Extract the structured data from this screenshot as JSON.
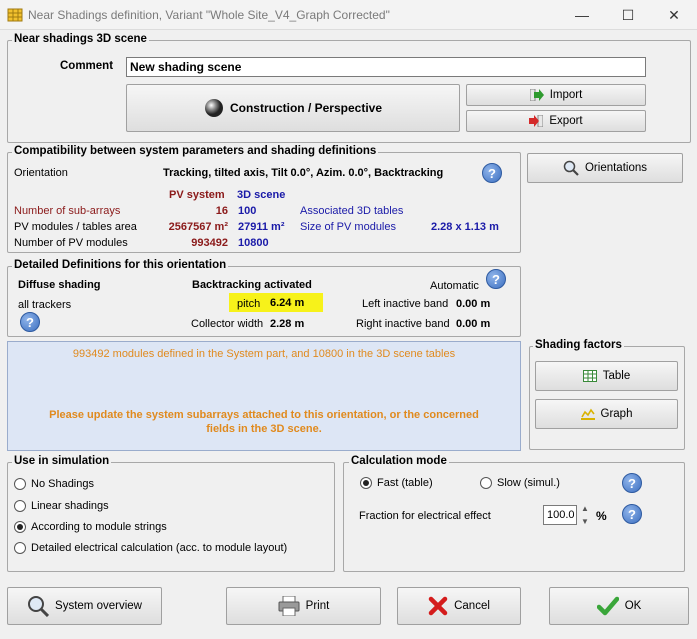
{
  "window": {
    "title": "Near Shadings definition, Variant \"Whole Site_V4_Graph Corrected\"",
    "minimize": "—",
    "maximize": "☐",
    "close": "✕"
  },
  "scene": {
    "group_label": "Near shadings 3D scene",
    "comment_label": "Comment",
    "comment_value": "New shading scene",
    "construction_label": "Construction / Perspective",
    "import_label": "Import",
    "export_label": "Export"
  },
  "compat": {
    "group_label": "Compatibility between system parameters and shading definitions",
    "orientation_label": "Orientation",
    "orientation_value": "Tracking, tilted axis, Tilt 0.0°, Azim. 0.0°, Backtracking",
    "pv_system_header": "PV system",
    "scene_header": "3D scene",
    "rows": [
      {
        "label": "Number of sub-arrays",
        "pv": "16",
        "scene": "100"
      },
      {
        "label": "PV modules / tables area",
        "pv": "2567567 m²",
        "scene": "27911 m²"
      },
      {
        "label": "Number of PV modules",
        "pv": "993492",
        "scene": "10800"
      }
    ],
    "associated_tables": "Associated 3D tables",
    "size_label": "Size of PV modules",
    "size_value": "2.28 x 1.13 m"
  },
  "orientations_button": "Orientations",
  "detailed": {
    "group_label": "Detailed Definitions for this orientation",
    "diffuse_label": "Diffuse shading",
    "diffuse_value": "all trackers",
    "backtracking": "Backtracking activated",
    "automatic": "Automatic",
    "pitch_label": "pitch",
    "pitch_value": "6.24 m",
    "collector_label": "Collector width",
    "collector_value": "2.28 m",
    "left_band_label": "Left inactive band",
    "left_band_value": "0.00 m",
    "right_band_label": "Right inactive band",
    "right_band_value": "0.00 m"
  },
  "info": {
    "line1": "993492 modules defined in the System part, and 10800 in the 3D scene tables",
    "line2": "Please update the system subarrays attached to this orientation, or the concerned",
    "line3": "fields in the 3D scene."
  },
  "shading_factors": {
    "group_label": "Shading factors",
    "table_label": "Table",
    "graph_label": "Graph"
  },
  "use_in_sim": {
    "group_label": "Use in simulation",
    "options": [
      "No Shadings",
      "Linear shadings",
      "According to module strings",
      "Detailed electrical calculation (acc. to module layout)"
    ],
    "selected_index": 2
  },
  "calc_mode": {
    "group_label": "Calculation mode",
    "fast_label": "Fast (table)",
    "slow_label": "Slow (simul.)",
    "fraction_label": "Fraction for electrical effect",
    "fraction_value": "100.0",
    "fraction_unit": "%"
  },
  "footer": {
    "system_overview": "System overview",
    "print": "Print",
    "cancel": "Cancel",
    "ok": "OK"
  },
  "help_glyph": "?"
}
